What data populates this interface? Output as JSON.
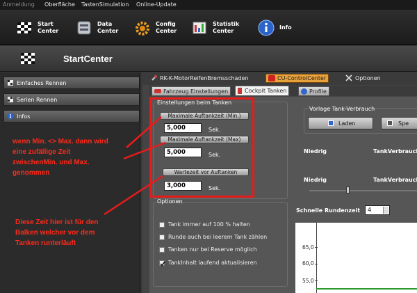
{
  "menu": {
    "items": [
      "Anmeldung",
      "Oberfläche",
      "TastenSimulation",
      "Online-Update"
    ]
  },
  "toolbar": {
    "start": [
      "Start",
      "Center"
    ],
    "data": [
      "Data",
      "Center"
    ],
    "config": [
      "Config",
      "Center"
    ],
    "statistik": [
      "Statistik",
      "Center"
    ],
    "info": "Info"
  },
  "header": {
    "title": "StartCenter"
  },
  "sidebar": {
    "items": [
      "Einfaches Rennen",
      "Serien Rennen",
      "Infos"
    ]
  },
  "tabs_top": [
    "RK-K-MotorReifenBremsschaden",
    "CU-ControlCenter",
    "Optionen"
  ],
  "tabs_sub": [
    "Fahrzeug Einstellungen",
    "Cockpit Tanken",
    "Profile"
  ],
  "tanken": {
    "group_title": "Einstellungen beim Tanken",
    "max_label": "Maximale Auftankzeit (Min.)",
    "max_value": "5,000",
    "max2_label": "Maximale Auftankzeit (Max)",
    "max2_value": "5,000",
    "wait_label": "Wartezeit vor Auftanken",
    "wait_value": "3,000",
    "unit": "Sek."
  },
  "optionen": {
    "title": "Optionen",
    "items": [
      {
        "label": "Tank immer auf 100 % halten",
        "checked": false
      },
      {
        "label": "Runde auch bei leerem Tank zählen",
        "checked": false
      },
      {
        "label": "Tanken nur bei Reserve möglich",
        "checked": false
      },
      {
        "label": "TankInhalt laufend aktualisieren",
        "checked": true
      }
    ]
  },
  "vorlage": {
    "title": "Vorlage Tank-Verbrauch",
    "laden": "Laden",
    "spe": "Spe"
  },
  "right": {
    "niedrig1": "Niedrig",
    "tank1": "TankVerbrauch",
    "niedrig2": "Niedrig",
    "tank2": "TankVerbrauch",
    "schnelle": "Schnelle Rundenzeit",
    "schnelle_value": "4"
  },
  "chart_data": {
    "type": "line",
    "ylabels": [
      "65,0",
      "60,0",
      "55,0"
    ]
  },
  "annotations": {
    "note1": [
      "wenn Min. <> Max. dann wird",
      "eine zufällige Zeit",
      "zwischenMin. und Max.",
      "genommen"
    ],
    "note2": [
      "Diese Zeit hier ist für den",
      "Balken welcher vor dem",
      "Tanken runterläuft"
    ]
  },
  "colors": {
    "accent": "#e8a23a",
    "annotation": "#e81b1b"
  }
}
